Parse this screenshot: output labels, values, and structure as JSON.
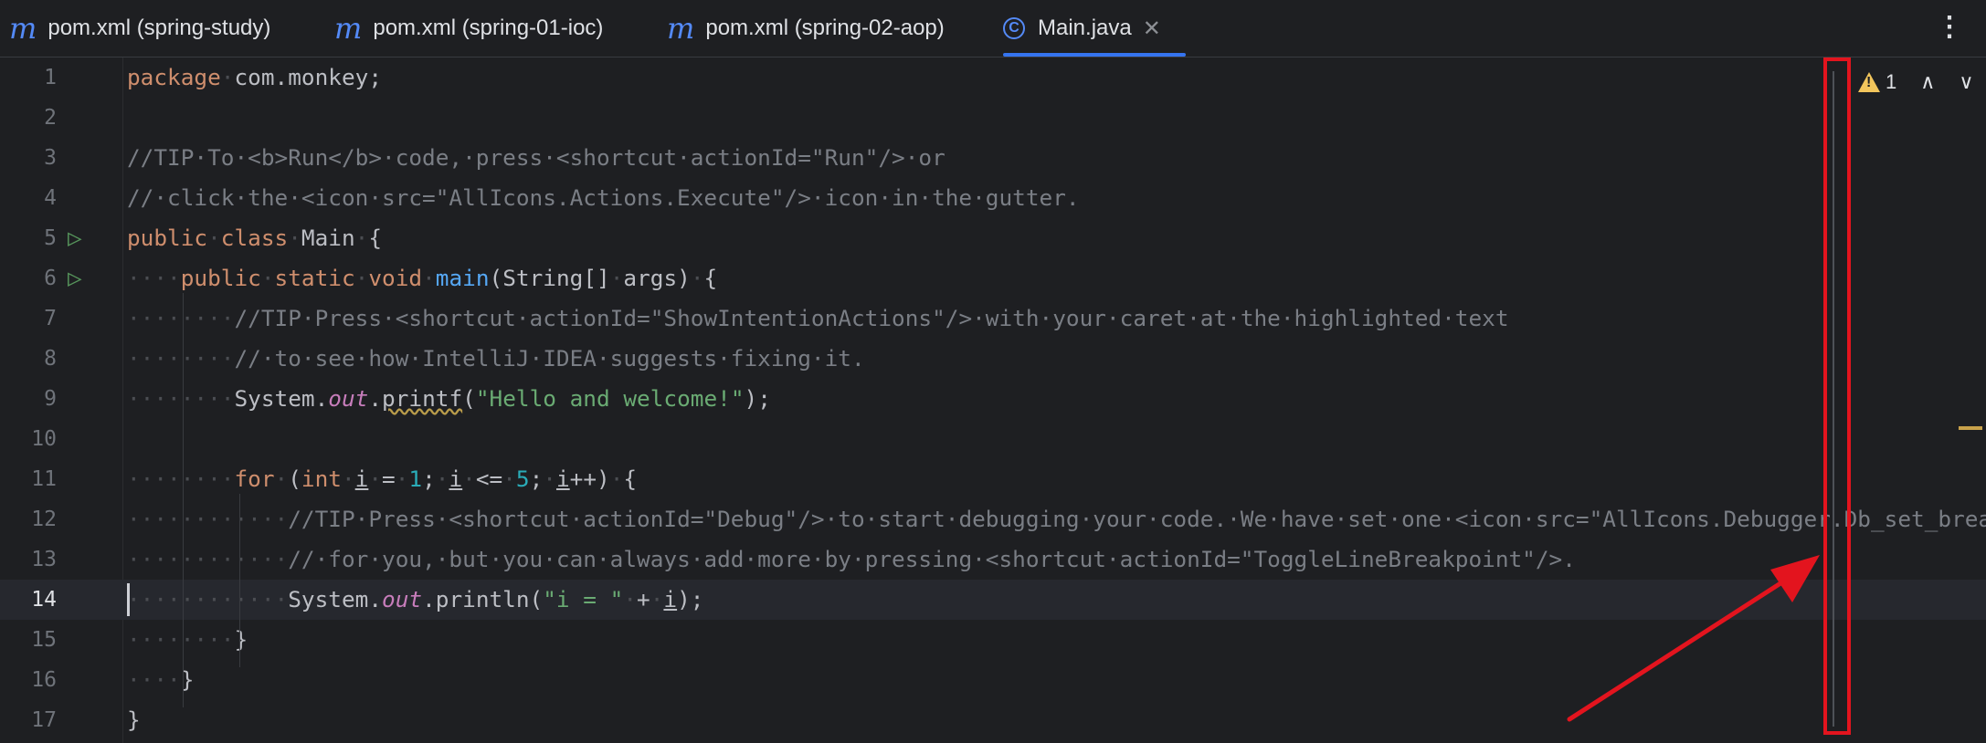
{
  "tabs": [
    {
      "label": "pom.xml (spring-study)",
      "icon": "m"
    },
    {
      "label": "pom.xml (spring-01-ioc)",
      "icon": "m"
    },
    {
      "label": "pom.xml (spring-02-aop)",
      "icon": "m"
    },
    {
      "label": "Main.java",
      "icon": "C",
      "active": true
    }
  ],
  "more_icon": "⋮",
  "close_icon": "✕",
  "inspections": {
    "warning_count": "1",
    "up_icon": "∧",
    "down_icon": "∨"
  },
  "colors": {
    "background": "#1e1f22",
    "keyword": "#cf8e6d",
    "comment": "#7a7e85",
    "string": "#6aab73",
    "number": "#2aacb8",
    "function": "#56a8f5",
    "field": "#c77dbb",
    "annotation_red": "#e3141e",
    "warning": "#f2c55c"
  },
  "lines": [
    {
      "num": "1",
      "indent": 0,
      "tokens": [
        [
          "kw",
          "package"
        ],
        [
          "ws",
          "·"
        ],
        [
          "tx",
          "com.monkey;"
        ]
      ]
    },
    {
      "num": "2",
      "indent": 0,
      "tokens": []
    },
    {
      "num": "3",
      "indent": 0,
      "tokens": [
        [
          "cm",
          "//TIP·To·<b>Run</b>·code,·press·<shortcut·actionId=\"Run\"/>·or"
        ]
      ]
    },
    {
      "num": "4",
      "indent": 0,
      "tokens": [
        [
          "cm",
          "//·click·the·<icon·src=\"AllIcons.Actions.Execute\"/>·icon·in·the·gutter."
        ]
      ]
    },
    {
      "num": "5",
      "indent": 0,
      "run": true,
      "tokens": [
        [
          "kw",
          "public"
        ],
        [
          "ws",
          "·"
        ],
        [
          "kw",
          "class"
        ],
        [
          "ws",
          "·"
        ],
        [
          "tx",
          "Main"
        ],
        [
          "ws",
          "·"
        ],
        [
          "tx",
          "{"
        ]
      ]
    },
    {
      "num": "6",
      "indent": 0,
      "run": true,
      "tokens": [
        [
          "ws",
          "····"
        ],
        [
          "kw",
          "public"
        ],
        [
          "ws",
          "·"
        ],
        [
          "kw",
          "static"
        ],
        [
          "ws",
          "·"
        ],
        [
          "kw",
          "void"
        ],
        [
          "ws",
          "·"
        ],
        [
          "fn",
          "main"
        ],
        [
          "tx",
          "(String[]"
        ],
        [
          "ws",
          "·"
        ],
        [
          "tx",
          "args)"
        ],
        [
          "ws",
          "·"
        ],
        [
          "tx",
          "{"
        ]
      ]
    },
    {
      "num": "7",
      "indent": 0,
      "tokens": [
        [
          "ws",
          "········"
        ],
        [
          "cm",
          "//TIP·Press·<shortcut·actionId=\"ShowIntentionActions\"/>·with·your·caret·at·the·highlighted·text"
        ]
      ]
    },
    {
      "num": "8",
      "indent": 0,
      "tokens": [
        [
          "ws",
          "········"
        ],
        [
          "cm",
          "//·to·see·how·IntelliJ·IDEA·suggests·fixing·it."
        ]
      ]
    },
    {
      "num": "9",
      "indent": 0,
      "tokens": [
        [
          "ws",
          "········"
        ],
        [
          "tx",
          "System."
        ],
        [
          "fld",
          "out"
        ],
        [
          "tx",
          "."
        ],
        [
          "wavy",
          "printf"
        ],
        [
          "tx",
          "("
        ],
        [
          "st",
          "\"Hello and welcome!\""
        ],
        [
          "tx",
          ");"
        ]
      ]
    },
    {
      "num": "10",
      "indent": 0,
      "tokens": []
    },
    {
      "num": "11",
      "indent": 0,
      "tokens": [
        [
          "ws",
          "········"
        ],
        [
          "kw",
          "for"
        ],
        [
          "ws",
          "·"
        ],
        [
          "tx",
          "("
        ],
        [
          "kw",
          "int"
        ],
        [
          "ws",
          "·"
        ],
        [
          "ul",
          "i"
        ],
        [
          "ws",
          "·"
        ],
        [
          "tx",
          "="
        ],
        [
          "ws",
          "·"
        ],
        [
          "nu",
          "1"
        ],
        [
          "tx",
          ";"
        ],
        [
          "ws",
          "·"
        ],
        [
          "ul",
          "i"
        ],
        [
          "ws",
          "·"
        ],
        [
          "tx",
          "<="
        ],
        [
          "ws",
          "·"
        ],
        [
          "nu",
          "5"
        ],
        [
          "tx",
          ";"
        ],
        [
          "ws",
          "·"
        ],
        [
          "ul",
          "i"
        ],
        [
          "tx",
          "++)"
        ],
        [
          "ws",
          "·"
        ],
        [
          "tx",
          "{"
        ]
      ]
    },
    {
      "num": "12",
      "indent": 0,
      "tokens": [
        [
          "ws",
          "············"
        ],
        [
          "cm",
          "//TIP·Press·<shortcut·actionId=\"Debug\"/>·to·start·debugging·your·code.·We·have·set·one·<icon·src=\"AllIcons.Debugger.Db_set_breakpoint\"/>"
        ]
      ]
    },
    {
      "num": "13",
      "indent": 0,
      "tokens": [
        [
          "ws",
          "············"
        ],
        [
          "cm",
          "//·for·you,·but·you·can·always·add·more·by·pressing·<shortcut·actionId=\"ToggleLineBreakpoint\"/>."
        ]
      ]
    },
    {
      "num": "14",
      "indent": 0,
      "current": true,
      "tokens": [
        [
          "ws",
          "············"
        ],
        [
          "tx",
          "System."
        ],
        [
          "fld",
          "out"
        ],
        [
          "tx",
          ".println("
        ],
        [
          "st",
          "\"i = \""
        ],
        [
          "ws",
          "·"
        ],
        [
          "tx",
          "+"
        ],
        [
          "ws",
          "·"
        ],
        [
          "ul",
          "i"
        ],
        [
          "tx",
          ");"
        ]
      ]
    },
    {
      "num": "15",
      "indent": 0,
      "tokens": [
        [
          "ws",
          "········"
        ],
        [
          "tx",
          "}"
        ]
      ]
    },
    {
      "num": "16",
      "indent": 0,
      "tokens": [
        [
          "ws",
          "····"
        ],
        [
          "tx",
          "}"
        ]
      ]
    },
    {
      "num": "17",
      "indent": 0,
      "tokens": [
        [
          "tx",
          "}"
        ]
      ]
    }
  ]
}
